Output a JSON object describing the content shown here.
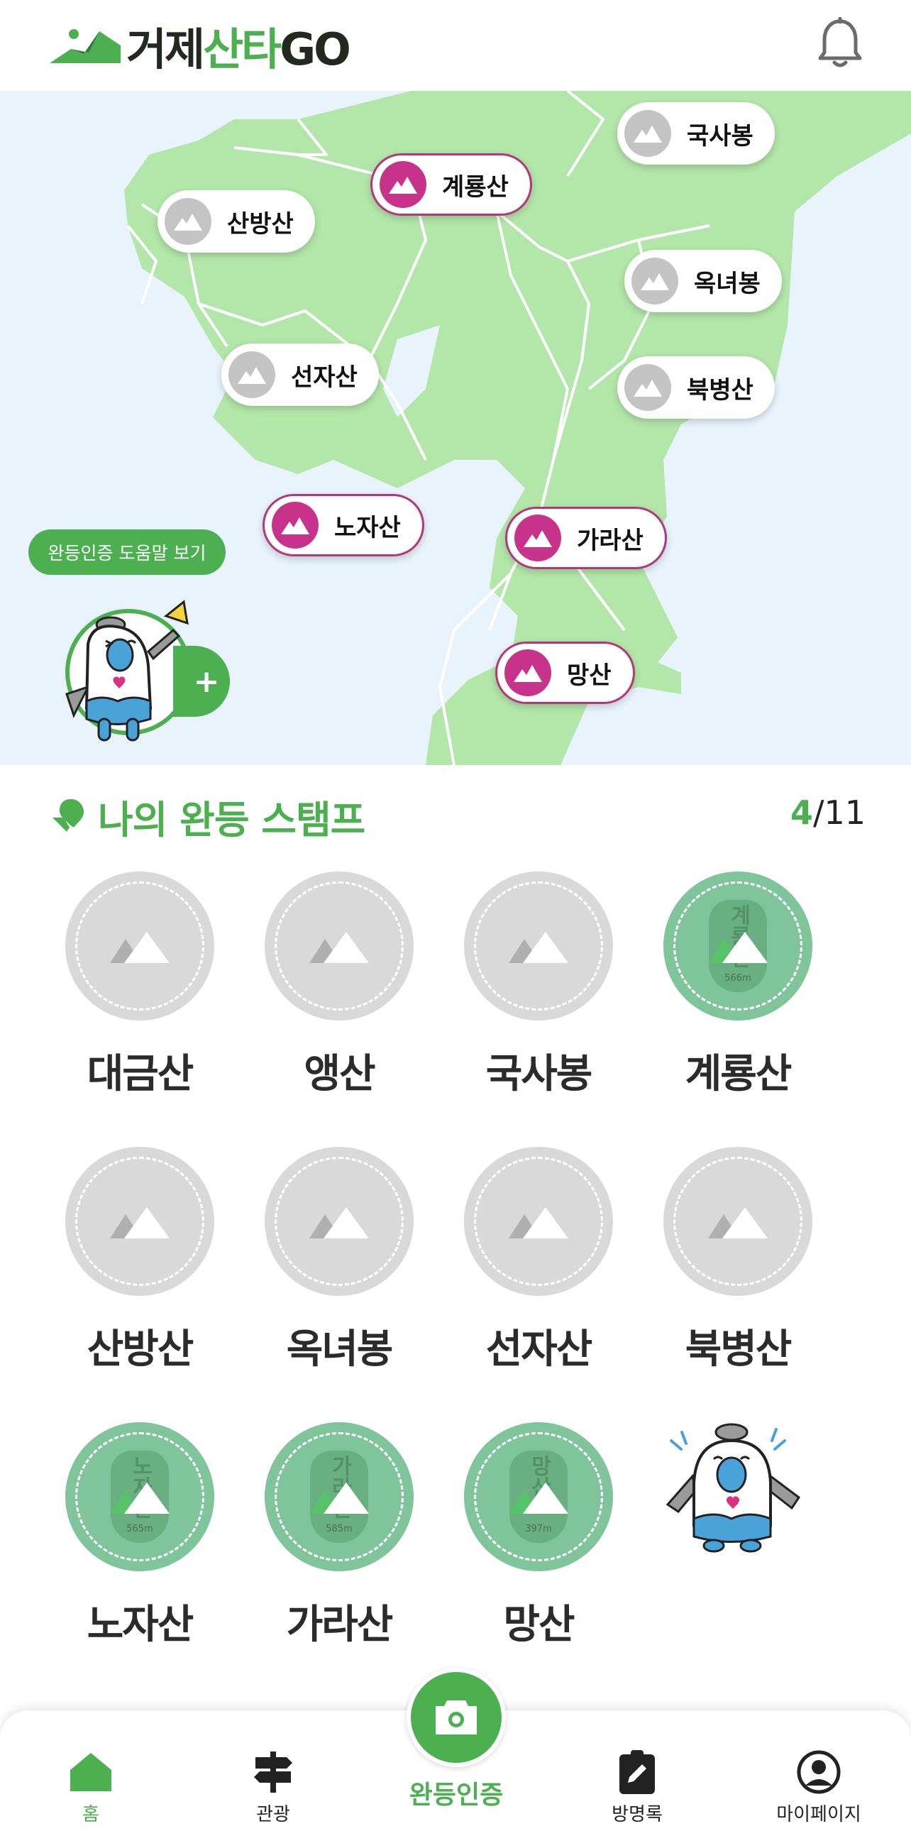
{
  "header": {
    "logo_part1": "거제",
    "logo_part2": "산타",
    "logo_part3": "GO",
    "notification_icon": "bell-icon"
  },
  "map": {
    "pins": [
      {
        "label": "국사봉",
        "completed": false
      },
      {
        "label": "계룡산",
        "completed": true
      },
      {
        "label": "산방산",
        "completed": false
      },
      {
        "label": "옥녀봉",
        "completed": false
      },
      {
        "label": "선자산",
        "completed": false
      },
      {
        "label": "북병산",
        "completed": false
      },
      {
        "label": "노자산",
        "completed": true
      },
      {
        "label": "가라산",
        "completed": true
      },
      {
        "label": "망산",
        "completed": true
      }
    ],
    "help_button": "완등인증 도움말 보기",
    "add_button": "+"
  },
  "stamps": {
    "title": "나의 완등 스탬프",
    "done_count": "4",
    "separator": "/",
    "total_count": "11",
    "items": [
      {
        "label": "대금산",
        "completed": false
      },
      {
        "label": "앵산",
        "completed": false
      },
      {
        "label": "국사봉",
        "completed": false
      },
      {
        "label": "계룡산",
        "completed": true,
        "stamp_text": "계룡산",
        "height": "566m"
      },
      {
        "label": "산방산",
        "completed": false
      },
      {
        "label": "옥녀봉",
        "completed": false
      },
      {
        "label": "선자산",
        "completed": false
      },
      {
        "label": "북병산",
        "completed": false
      },
      {
        "label": "노자산",
        "completed": true,
        "stamp_text": "노자산",
        "height": "565m"
      },
      {
        "label": "가라산",
        "completed": true,
        "stamp_text": "가라산",
        "height": "585m"
      },
      {
        "label": "망산",
        "completed": true,
        "stamp_text": "망산",
        "height": "397m"
      }
    ]
  },
  "nav": {
    "items": [
      {
        "label": "홈",
        "icon": "home-icon",
        "active": true
      },
      {
        "label": "관광",
        "icon": "signpost-icon",
        "active": false
      },
      {
        "label": "완등인증",
        "icon": "camera-icon",
        "active": true
      },
      {
        "label": "방명록",
        "icon": "clipboard-edit-icon",
        "active": false
      },
      {
        "label": "마이페이지",
        "icon": "account-icon",
        "active": false
      }
    ]
  },
  "colors": {
    "accent": "#4caf50",
    "completed_pin": "#c7338a",
    "map_land": "#b3e6a9",
    "map_sea": "#e8f3fb",
    "inactive": "#d9d9d9"
  }
}
